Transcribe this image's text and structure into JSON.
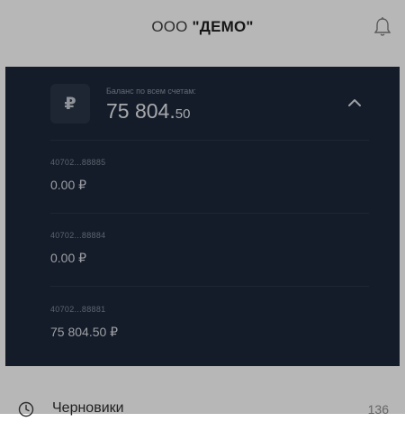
{
  "header": {
    "org_prefix": "ООО ",
    "org_name": "\"ДЕМО\"",
    "bell_icon": "bell-icon"
  },
  "balance": {
    "currency_symbol": "₽",
    "label": "Баланс по всем счетам:",
    "amount_main": "75 804.",
    "amount_cents": "50",
    "toggle_icon": "chevron-up-icon"
  },
  "accounts": [
    {
      "number": "40702...88885",
      "amount": "0.00 ₽"
    },
    {
      "number": "40702...88884",
      "amount": "0.00 ₽"
    },
    {
      "number": "40702...88881",
      "amount": "75 804.50 ₽"
    }
  ],
  "drafts": {
    "label": "Черновики",
    "count": "136",
    "icon": "clock-icon"
  },
  "colors": {
    "panel_bg": "#0f1a2e",
    "overlay": "rgba(30,30,30,0.32)"
  }
}
